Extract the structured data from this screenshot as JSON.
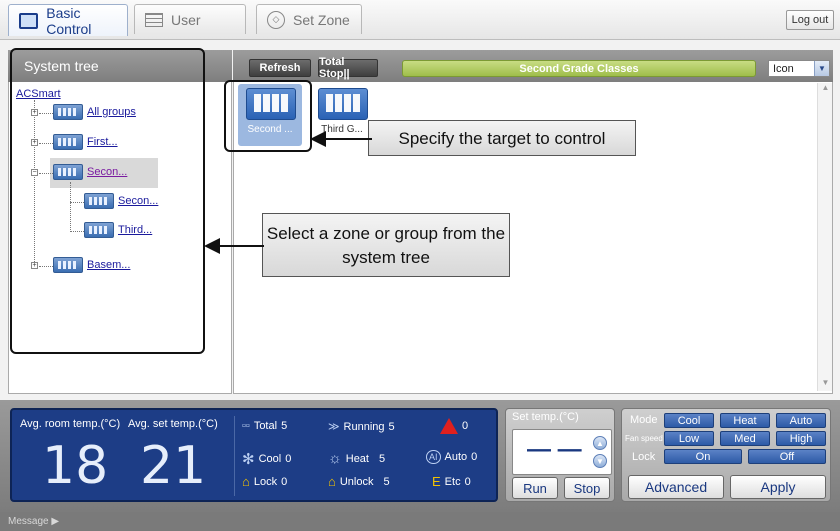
{
  "tabs": [
    {
      "label": "Basic Control",
      "icon": "monitor-icon",
      "active": true
    },
    {
      "label": "User",
      "icon": "list-icon",
      "active": false
    },
    {
      "label": "Set Zone",
      "icon": "zone-icon",
      "active": false
    }
  ],
  "logout_label": "Log out",
  "system_tree": {
    "title": "System tree",
    "root": "ACSmart",
    "nodes": [
      "All groups",
      "First...",
      "Secon...",
      "Secon...",
      "Third...",
      "Basem..."
    ]
  },
  "toolbar": {
    "refresh_label": "Refresh",
    "total_stop_label": "Total Stop||",
    "zone_title": "Second Grade Classes",
    "view_select": "Icon"
  },
  "zone_items": [
    {
      "label": "Second ...",
      "selected": true
    },
    {
      "label": "Third G...",
      "selected": false
    }
  ],
  "callouts": {
    "target": "Specify the target to control",
    "tree": "Select a zone or group from the system tree"
  },
  "status": {
    "avg_room_label": "Avg. room temp.(°C)",
    "avg_set_label": "Avg. set temp.(°C)",
    "avg_room_value": "18",
    "avg_set_value": "21",
    "total_label": "Total",
    "total_value": "5",
    "running_label": "Running",
    "running_value": "5",
    "alarm_value": "0",
    "cool_label": "Cool",
    "cool_value": "0",
    "heat_label": "Heat",
    "heat_value": "5",
    "auto_label": "Auto",
    "auto_value": "0",
    "lock_label": "Lock",
    "lock_value": "0",
    "unlock_label": "Unlock",
    "unlock_value": "5",
    "etc_label": "Etc",
    "etc_value": "0"
  },
  "set_temp": {
    "title": "Set temp.(°C)",
    "display": "— —",
    "run_label": "Run",
    "stop_label": "Stop"
  },
  "modes": {
    "mode_label": "Mode",
    "mode_options": [
      "Cool",
      "Heat",
      "Auto"
    ],
    "fan_label": "Fan speed",
    "fan_options": [
      "Low",
      "Med",
      "High"
    ],
    "lock_label": "Lock",
    "lock_options": [
      "On",
      "Off"
    ],
    "advanced_label": "Advanced",
    "apply_label": "Apply"
  },
  "message_label": "Message ▶"
}
